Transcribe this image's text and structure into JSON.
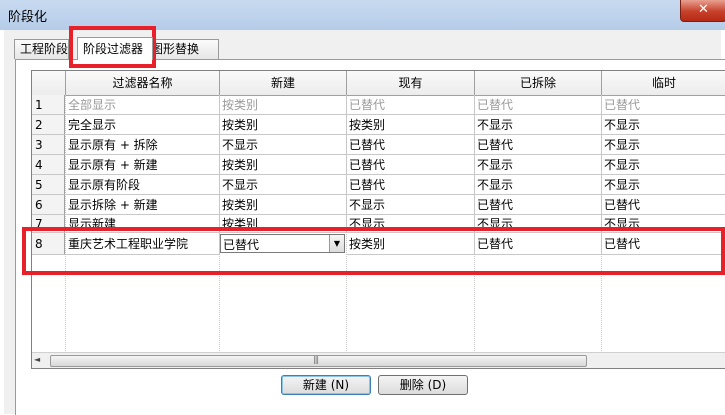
{
  "window": {
    "title": "阶段化",
    "close_glyph": "✕"
  },
  "tabs": [
    {
      "label": "工程阶段",
      "active": false
    },
    {
      "label": "阶段过滤器",
      "active": true
    },
    {
      "label": "图形替换",
      "active": false
    }
  ],
  "table": {
    "columns": [
      "过滤器名称",
      "新建",
      "现有",
      "已拆除",
      "临时"
    ],
    "rows": [
      {
        "num": "1",
        "name": "全部显示",
        "new": "按类别",
        "existing": "已替代",
        "demolished": "已替代",
        "temporary": "已替代",
        "greyed": true
      },
      {
        "num": "2",
        "name": "完全显示",
        "new": "按类别",
        "existing": "按类别",
        "demolished": "不显示",
        "temporary": "不显示",
        "greyed": false
      },
      {
        "num": "3",
        "name": "显示原有 + 拆除",
        "new": "不显示",
        "existing": "已替代",
        "demolished": "已替代",
        "temporary": "不显示",
        "greyed": false
      },
      {
        "num": "4",
        "name": "显示原有 + 新建",
        "new": "按类别",
        "existing": "已替代",
        "demolished": "不显示",
        "temporary": "不显示",
        "greyed": false
      },
      {
        "num": "5",
        "name": "显示原有阶段",
        "new": "不显示",
        "existing": "已替代",
        "demolished": "不显示",
        "temporary": "不显示",
        "greyed": false
      },
      {
        "num": "6",
        "name": "显示拆除 + 新建",
        "new": "按类别",
        "existing": "不显示",
        "demolished": "已替代",
        "temporary": "已替代",
        "greyed": false
      },
      {
        "num": "7",
        "name": "显示新建",
        "new": "按类别",
        "existing": "不显示",
        "demolished": "不显示",
        "temporary": "不显示",
        "greyed": false
      },
      {
        "num": "8",
        "name": "重庆艺术工程职业学院",
        "new": "已替代",
        "existing": "按类别",
        "demolished": "已替代",
        "temporary": "已替代",
        "greyed": false
      }
    ]
  },
  "scrollbar": {
    "left_arrow": "◄",
    "grip": "|||"
  },
  "combo_arrow": "▼",
  "buttons": {
    "new": "新建 (N)",
    "delete": "删除 (D)"
  },
  "colors": {
    "highlight": "#e8202a"
  }
}
